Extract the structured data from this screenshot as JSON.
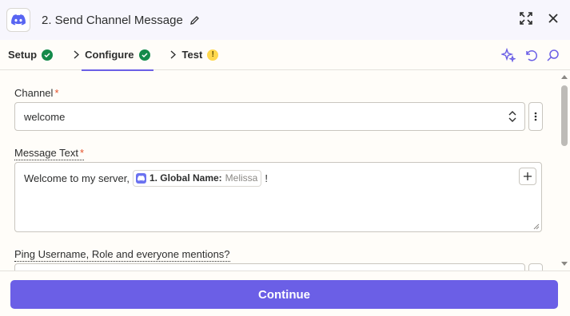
{
  "header": {
    "title": "2. Send Channel Message",
    "icons": {
      "app": "discord-icon",
      "edit": "pencil-icon",
      "expand": "expand-icon",
      "close": "close-icon"
    }
  },
  "tabs": [
    {
      "label": "Setup",
      "status": "complete"
    },
    {
      "label": "Configure",
      "status": "complete",
      "active": true
    },
    {
      "label": "Test",
      "status": "warning",
      "status_glyph": "!"
    }
  ],
  "toolbar": {
    "icons": [
      "sparkle-icon",
      "undo-icon",
      "search-icon"
    ]
  },
  "fields": {
    "channel": {
      "label": "Channel",
      "required_mark": "*",
      "value": "welcome"
    },
    "message": {
      "label": "Message Text",
      "required_mark": "*",
      "prefix": "Welcome to my server,",
      "pill_key": "1. Global Name:",
      "pill_value": "Melissa",
      "suffix": "!"
    },
    "ping": {
      "label": "Ping Username, Role and everyone mentions?"
    }
  },
  "footer": {
    "continue_label": "Continue"
  },
  "colors": {
    "accent": "#6b5fe6",
    "success": "#138a4a",
    "warning": "#ffd84d",
    "required": "#e5532c"
  }
}
